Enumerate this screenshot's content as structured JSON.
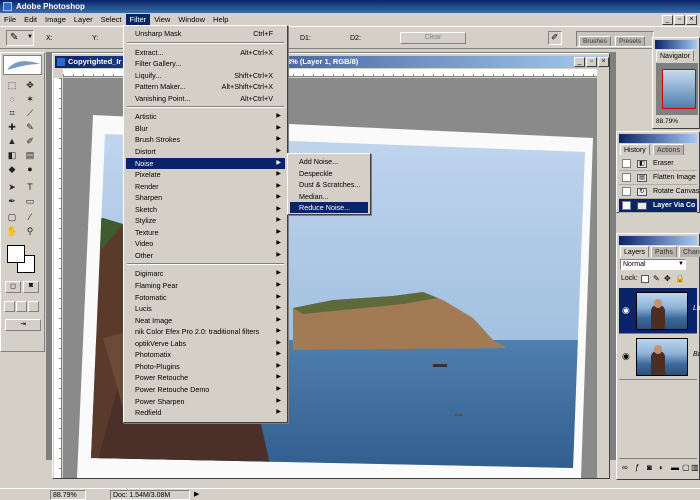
{
  "app": {
    "title": "Adobe Photoshop"
  },
  "menubar": [
    "File",
    "Edit",
    "Image",
    "Layer",
    "Select",
    "Filter",
    "View",
    "Window",
    "Help"
  ],
  "options": {
    "x_label": "X:",
    "y_label": "Y:",
    "d1_label": "D1:",
    "d2_label": "D2:",
    "clear_label": "Clear"
  },
  "dock_tabs": {
    "brushes": "Brushes",
    "presets": "Presets"
  },
  "document": {
    "title_left": "Copyrighted_Ir",
    "title_right": "8% (Layer 1, RGB/8)"
  },
  "filter_menu": {
    "top": [
      {
        "label": "Unsharp Mask",
        "shortcut": "Ctrl+F"
      }
    ],
    "group2": [
      {
        "label": "Extract...",
        "shortcut": "Alt+Ctrl+X"
      },
      {
        "label": "Filter Gallery...",
        "shortcut": ""
      },
      {
        "label": "Liquify...",
        "shortcut": "Shift+Ctrl+X"
      },
      {
        "label": "Pattern Maker...",
        "shortcut": "Alt+Shift+Ctrl+X"
      },
      {
        "label": "Vanishing Point...",
        "shortcut": "Alt+Ctrl+V"
      }
    ],
    "group3": [
      "Artistic",
      "Blur",
      "Brush Strokes",
      "Distort",
      "Noise",
      "Pixelate",
      "Render",
      "Sharpen",
      "Sketch",
      "Stylize",
      "Texture",
      "Video",
      "Other"
    ],
    "group4": [
      "Digimarc",
      "Flaming Pear",
      "Fotomatic",
      "Lucis",
      "Neat Image",
      "nik Color Efex Pro 2.0: traditional filters",
      "optikVerve Labs",
      "Photomatix",
      "Photo-Plugins",
      "Power Retouche",
      "Power Retouche Demo",
      "Power Sharpen",
      "Redfield"
    ],
    "highlighted": "Noise"
  },
  "noise_submenu": {
    "items": [
      "Add Noise...",
      "Despeckle",
      "Dust & Scratches...",
      "Median...",
      "Reduce Noise..."
    ],
    "highlighted": "Reduce Noise..."
  },
  "navigator": {
    "tab": "Navigator",
    "zoom": "88.79%"
  },
  "history": {
    "tabs": [
      "History",
      "Actions"
    ],
    "items": [
      "Eraser",
      "Flatten Image",
      "Rotate Canvas",
      "Layer Via Co"
    ],
    "selected": "Layer Via Co"
  },
  "layers": {
    "tabs": [
      "Layers",
      "Paths",
      "Chann"
    ],
    "blend_mode": "Normal",
    "lock_label": "Lock:",
    "items": [
      {
        "name": "La"
      },
      {
        "name": "Ba"
      }
    ]
  },
  "status": {
    "zoom": "88.79%",
    "doc": "Doc: 1.54M/3.08M"
  },
  "colors": {
    "menu_highlight": "#0a246a",
    "chrome": "#d4d0c8",
    "sky": "#8fb3d9",
    "sea": "#2e5b8a"
  }
}
